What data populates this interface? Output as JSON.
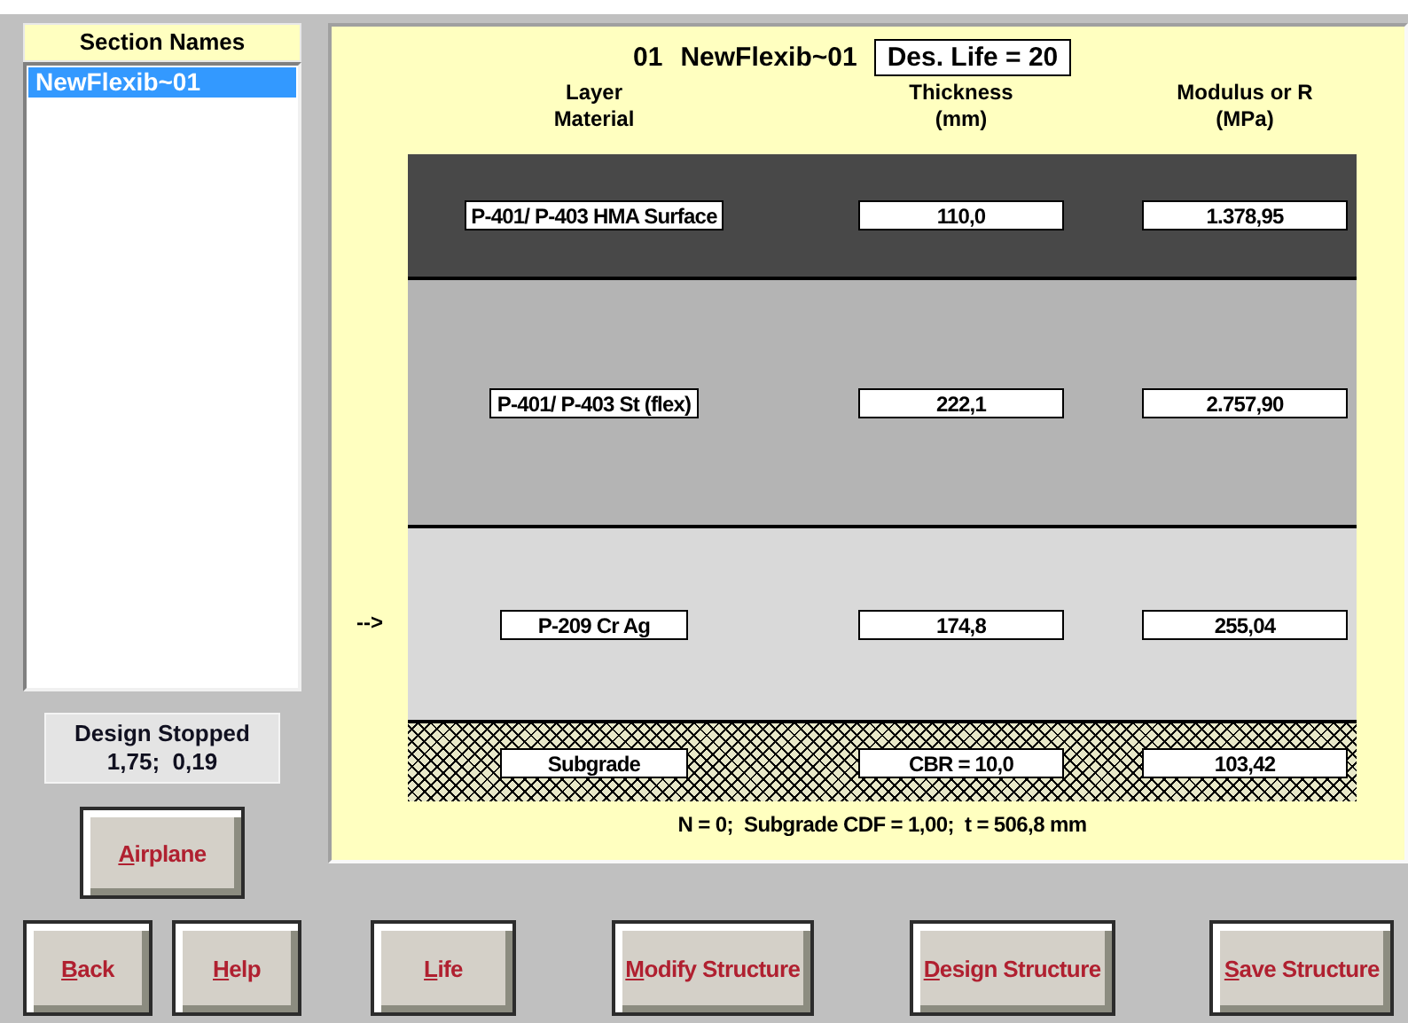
{
  "section_list": {
    "title": "Section Names",
    "items": [
      {
        "label": "NewFlexib~01",
        "selected": true
      }
    ]
  },
  "status": {
    "title": "Design Stopped",
    "values": "1,75;  0,19"
  },
  "airplane_button": "Airplane",
  "structure": {
    "number": "01",
    "name": "NewFlexib~01",
    "design_life": "Des. Life = 20",
    "columns": [
      "Layer\nMaterial",
      "Thickness\n(mm)",
      "Modulus or R\n(MPa)"
    ],
    "layers": [
      {
        "kind": "surface",
        "material": "P-401/ P-403 HMA Surface",
        "thickness": "110,0",
        "modulus": "1.378,95"
      },
      {
        "kind": "base",
        "material": "P-401/ P-403 St (flex)",
        "thickness": "222,1",
        "modulus": "2.757,90"
      },
      {
        "kind": "subbase",
        "material": "P-209 Cr Ag",
        "thickness": "174,8",
        "modulus": "255,04",
        "marker": "-->"
      },
      {
        "kind": "subgrade",
        "material": "Subgrade",
        "thickness": "CBR = 10,0",
        "modulus": "103,42"
      }
    ],
    "summary": "N = 0;  Subgrade CDF = 1,00;  t = 506,8 mm"
  },
  "nav_buttons": [
    "Back",
    "Help"
  ],
  "action_buttons": [
    "Life",
    "Modify Structure",
    "Design Structure",
    "Save Structure"
  ]
}
